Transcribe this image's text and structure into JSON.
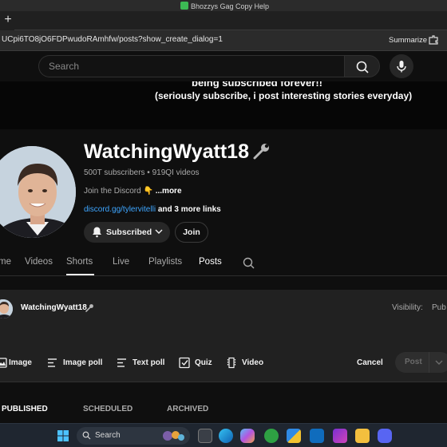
{
  "window": {
    "title": "Bhozzys Gag Copy Help"
  },
  "browser": {
    "url": "UCpi6TO8jO6FDPwudoRAmhfw/posts?show_create_dialog=1",
    "summarize_label": "Summarize"
  },
  "youtube": {
    "search_placeholder": "Search"
  },
  "banner": {
    "line1": "being subscribed forever!!",
    "line2": "(seriously subscribe, i post interesting stories everyday)"
  },
  "channel": {
    "name": "WatchingWyatt18",
    "meta": "500T subscribers • 919QI videos",
    "description": "Join the Discord 👇 ",
    "description_more": "...more",
    "link": "discord.gg/tylervitelli",
    "more_links": " and 3 more links",
    "subscribed_label": "Subscribed",
    "join_label": "Join"
  },
  "tabs": [
    {
      "label": "Home",
      "display": "me"
    },
    {
      "label": "Videos",
      "display": "Videos"
    },
    {
      "label": "Shorts",
      "display": "Shorts"
    },
    {
      "label": "Live",
      "display": "Live"
    },
    {
      "label": "Playlists",
      "display": "Playlists"
    },
    {
      "label": "Posts",
      "display": "Posts"
    }
  ],
  "active_tab": "Posts",
  "dialog": {
    "username": "WatchingWyatt18",
    "visibility_label": "Visibility:",
    "visibility_value": "Pub",
    "tools": [
      {
        "label": "Image",
        "icon": "image-icon"
      },
      {
        "label": "Image poll",
        "icon": "image-poll-icon"
      },
      {
        "label": "Text poll",
        "icon": "text-poll-icon"
      },
      {
        "label": "Quiz",
        "icon": "quiz-icon"
      },
      {
        "label": "Video",
        "icon": "video-icon"
      }
    ],
    "cancel_label": "Cancel",
    "post_label": "Post"
  },
  "post_tabs": [
    {
      "label": "PUBLISHED"
    },
    {
      "label": "SCHEDULED"
    },
    {
      "label": "ARCHIVED"
    }
  ],
  "taskbar": {
    "search_label": "Search",
    "apps": [
      "file-explorer-icon",
      "edge-icon",
      "copilot-icon",
      "xbox-icon",
      "store-icon",
      "outlook-icon",
      "purple-app-icon",
      "folder-icon",
      "discord-icon"
    ]
  },
  "colors": {
    "background": "#0f0f0f",
    "link": "#3ea6ff",
    "dialog": "#212121"
  }
}
